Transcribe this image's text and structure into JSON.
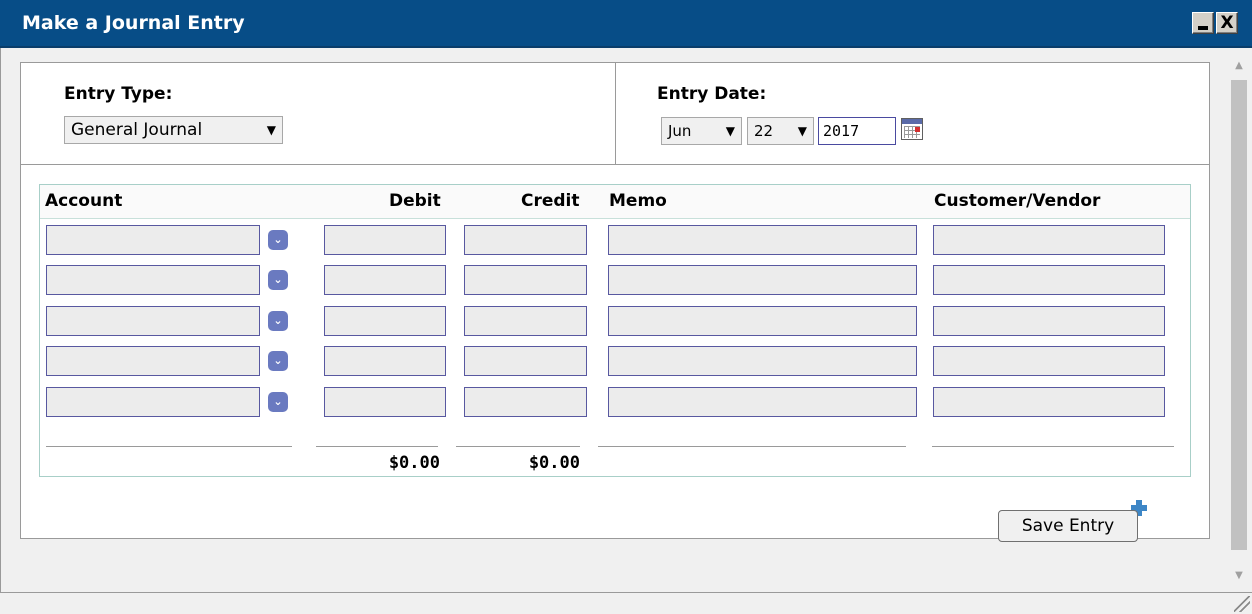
{
  "window": {
    "title": "Make a Journal Entry",
    "close_glyph": "X"
  },
  "entry_type": {
    "label": "Entry Type:",
    "selected": "General Journal"
  },
  "entry_date": {
    "label": "Entry Date:",
    "month": "Jun",
    "day": "22",
    "year": "2017"
  },
  "grid": {
    "headers": {
      "account": "Account",
      "debit": "Debit",
      "credit": "Credit",
      "memo": "Memo",
      "customer_vendor": "Customer/Vendor"
    },
    "rows": [
      {
        "account": "",
        "debit": "",
        "credit": "",
        "memo": "",
        "customer_vendor": ""
      },
      {
        "account": "",
        "debit": "",
        "credit": "",
        "memo": "",
        "customer_vendor": ""
      },
      {
        "account": "",
        "debit": "",
        "credit": "",
        "memo": "",
        "customer_vendor": ""
      },
      {
        "account": "",
        "debit": "",
        "credit": "",
        "memo": "",
        "customer_vendor": ""
      },
      {
        "account": "",
        "debit": "",
        "credit": "",
        "memo": "",
        "customer_vendor": ""
      }
    ],
    "totals": {
      "debit": "$0.00",
      "credit": "$0.00"
    }
  },
  "actions": {
    "save_label": "Save Entry",
    "add_row_icon": "plus-icon"
  },
  "colors": {
    "titlebar": "#074d87",
    "field_border": "#5858a0",
    "dropdown_icon": "#6a7ac0",
    "grid_border": "#a8cfc8",
    "add_icon": "#3d86c6"
  }
}
